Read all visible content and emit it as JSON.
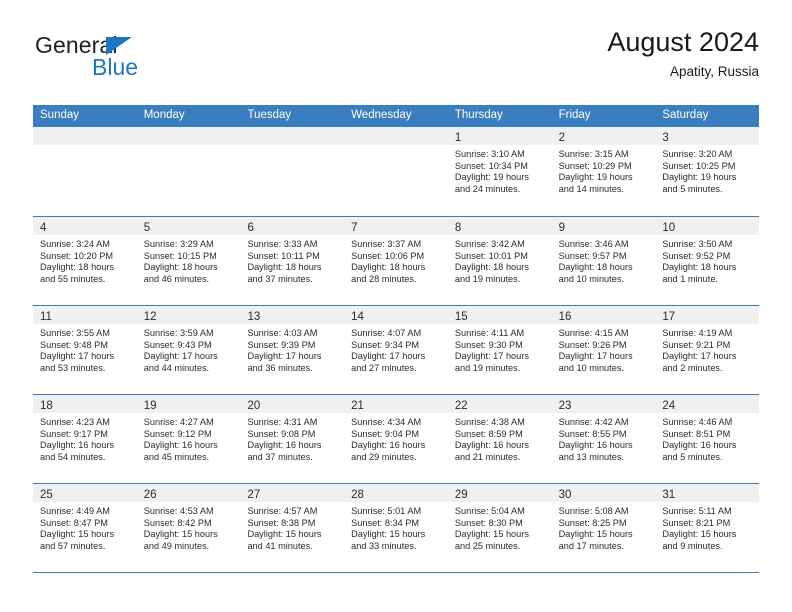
{
  "brand": {
    "name_part1": "General",
    "name_part2": "Blue",
    "accent_color": "#1d76c4"
  },
  "header": {
    "title": "August 2024",
    "subtitle": "Apatity, Russia"
  },
  "theme": {
    "header_blue": "#3a7ebf",
    "daynum_band": "#f0f0f0",
    "text": "#2b2b2b"
  },
  "calendar": {
    "day_names": [
      "Sunday",
      "Monday",
      "Tuesday",
      "Wednesday",
      "Thursday",
      "Friday",
      "Saturday"
    ],
    "weeks": [
      [
        {
          "day": "",
          "empty": true
        },
        {
          "day": "",
          "empty": true
        },
        {
          "day": "",
          "empty": true
        },
        {
          "day": "",
          "empty": true
        },
        {
          "day": "1",
          "sunrise": "Sunrise: 3:10 AM",
          "sunset": "Sunset: 10:34 PM",
          "daylight1": "Daylight: 19 hours",
          "daylight2": "and 24 minutes."
        },
        {
          "day": "2",
          "sunrise": "Sunrise: 3:15 AM",
          "sunset": "Sunset: 10:29 PM",
          "daylight1": "Daylight: 19 hours",
          "daylight2": "and 14 minutes."
        },
        {
          "day": "3",
          "sunrise": "Sunrise: 3:20 AM",
          "sunset": "Sunset: 10:25 PM",
          "daylight1": "Daylight: 19 hours",
          "daylight2": "and 5 minutes."
        }
      ],
      [
        {
          "day": "4",
          "sunrise": "Sunrise: 3:24 AM",
          "sunset": "Sunset: 10:20 PM",
          "daylight1": "Daylight: 18 hours",
          "daylight2": "and 55 minutes."
        },
        {
          "day": "5",
          "sunrise": "Sunrise: 3:29 AM",
          "sunset": "Sunset: 10:15 PM",
          "daylight1": "Daylight: 18 hours",
          "daylight2": "and 46 minutes."
        },
        {
          "day": "6",
          "sunrise": "Sunrise: 3:33 AM",
          "sunset": "Sunset: 10:11 PM",
          "daylight1": "Daylight: 18 hours",
          "daylight2": "and 37 minutes."
        },
        {
          "day": "7",
          "sunrise": "Sunrise: 3:37 AM",
          "sunset": "Sunset: 10:06 PM",
          "daylight1": "Daylight: 18 hours",
          "daylight2": "and 28 minutes."
        },
        {
          "day": "8",
          "sunrise": "Sunrise: 3:42 AM",
          "sunset": "Sunset: 10:01 PM",
          "daylight1": "Daylight: 18 hours",
          "daylight2": "and 19 minutes."
        },
        {
          "day": "9",
          "sunrise": "Sunrise: 3:46 AM",
          "sunset": "Sunset: 9:57 PM",
          "daylight1": "Daylight: 18 hours",
          "daylight2": "and 10 minutes."
        },
        {
          "day": "10",
          "sunrise": "Sunrise: 3:50 AM",
          "sunset": "Sunset: 9:52 PM",
          "daylight1": "Daylight: 18 hours",
          "daylight2": "and 1 minute."
        }
      ],
      [
        {
          "day": "11",
          "sunrise": "Sunrise: 3:55 AM",
          "sunset": "Sunset: 9:48 PM",
          "daylight1": "Daylight: 17 hours",
          "daylight2": "and 53 minutes."
        },
        {
          "day": "12",
          "sunrise": "Sunrise: 3:59 AM",
          "sunset": "Sunset: 9:43 PM",
          "daylight1": "Daylight: 17 hours",
          "daylight2": "and 44 minutes."
        },
        {
          "day": "13",
          "sunrise": "Sunrise: 4:03 AM",
          "sunset": "Sunset: 9:39 PM",
          "daylight1": "Daylight: 17 hours",
          "daylight2": "and 36 minutes."
        },
        {
          "day": "14",
          "sunrise": "Sunrise: 4:07 AM",
          "sunset": "Sunset: 9:34 PM",
          "daylight1": "Daylight: 17 hours",
          "daylight2": "and 27 minutes."
        },
        {
          "day": "15",
          "sunrise": "Sunrise: 4:11 AM",
          "sunset": "Sunset: 9:30 PM",
          "daylight1": "Daylight: 17 hours",
          "daylight2": "and 19 minutes."
        },
        {
          "day": "16",
          "sunrise": "Sunrise: 4:15 AM",
          "sunset": "Sunset: 9:26 PM",
          "daylight1": "Daylight: 17 hours",
          "daylight2": "and 10 minutes."
        },
        {
          "day": "17",
          "sunrise": "Sunrise: 4:19 AM",
          "sunset": "Sunset: 9:21 PM",
          "daylight1": "Daylight: 17 hours",
          "daylight2": "and 2 minutes."
        }
      ],
      [
        {
          "day": "18",
          "sunrise": "Sunrise: 4:23 AM",
          "sunset": "Sunset: 9:17 PM",
          "daylight1": "Daylight: 16 hours",
          "daylight2": "and 54 minutes."
        },
        {
          "day": "19",
          "sunrise": "Sunrise: 4:27 AM",
          "sunset": "Sunset: 9:12 PM",
          "daylight1": "Daylight: 16 hours",
          "daylight2": "and 45 minutes."
        },
        {
          "day": "20",
          "sunrise": "Sunrise: 4:31 AM",
          "sunset": "Sunset: 9:08 PM",
          "daylight1": "Daylight: 16 hours",
          "daylight2": "and 37 minutes."
        },
        {
          "day": "21",
          "sunrise": "Sunrise: 4:34 AM",
          "sunset": "Sunset: 9:04 PM",
          "daylight1": "Daylight: 16 hours",
          "daylight2": "and 29 minutes."
        },
        {
          "day": "22",
          "sunrise": "Sunrise: 4:38 AM",
          "sunset": "Sunset: 8:59 PM",
          "daylight1": "Daylight: 16 hours",
          "daylight2": "and 21 minutes."
        },
        {
          "day": "23",
          "sunrise": "Sunrise: 4:42 AM",
          "sunset": "Sunset: 8:55 PM",
          "daylight1": "Daylight: 16 hours",
          "daylight2": "and 13 minutes."
        },
        {
          "day": "24",
          "sunrise": "Sunrise: 4:46 AM",
          "sunset": "Sunset: 8:51 PM",
          "daylight1": "Daylight: 16 hours",
          "daylight2": "and 5 minutes."
        }
      ],
      [
        {
          "day": "25",
          "sunrise": "Sunrise: 4:49 AM",
          "sunset": "Sunset: 8:47 PM",
          "daylight1": "Daylight: 15 hours",
          "daylight2": "and 57 minutes."
        },
        {
          "day": "26",
          "sunrise": "Sunrise: 4:53 AM",
          "sunset": "Sunset: 8:42 PM",
          "daylight1": "Daylight: 15 hours",
          "daylight2": "and 49 minutes."
        },
        {
          "day": "27",
          "sunrise": "Sunrise: 4:57 AM",
          "sunset": "Sunset: 8:38 PM",
          "daylight1": "Daylight: 15 hours",
          "daylight2": "and 41 minutes."
        },
        {
          "day": "28",
          "sunrise": "Sunrise: 5:01 AM",
          "sunset": "Sunset: 8:34 PM",
          "daylight1": "Daylight: 15 hours",
          "daylight2": "and 33 minutes."
        },
        {
          "day": "29",
          "sunrise": "Sunrise: 5:04 AM",
          "sunset": "Sunset: 8:30 PM",
          "daylight1": "Daylight: 15 hours",
          "daylight2": "and 25 minutes."
        },
        {
          "day": "30",
          "sunrise": "Sunrise: 5:08 AM",
          "sunset": "Sunset: 8:25 PM",
          "daylight1": "Daylight: 15 hours",
          "daylight2": "and 17 minutes."
        },
        {
          "day": "31",
          "sunrise": "Sunrise: 5:11 AM",
          "sunset": "Sunset: 8:21 PM",
          "daylight1": "Daylight: 15 hours",
          "daylight2": "and 9 minutes."
        }
      ]
    ]
  }
}
